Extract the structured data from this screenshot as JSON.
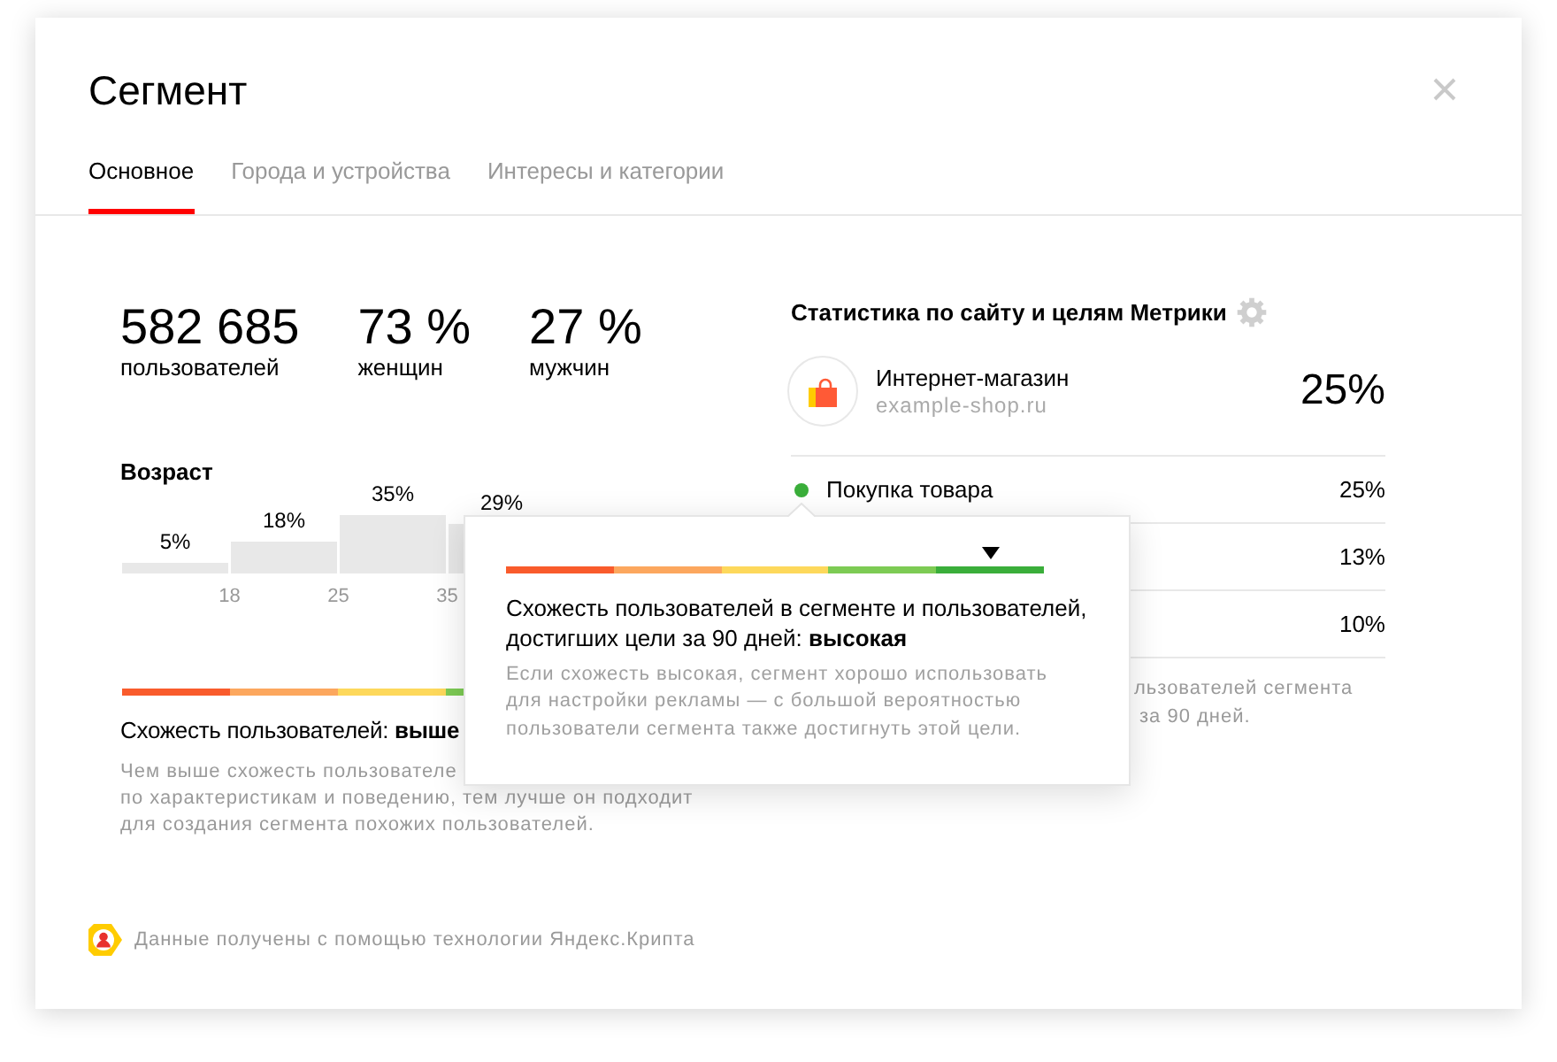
{
  "dialog": {
    "title": "Сегмент"
  },
  "tabs": [
    {
      "label": "Основное",
      "selected": true
    },
    {
      "label": "Города и устройства",
      "selected": false
    },
    {
      "label": "Интересы и категории",
      "selected": false
    }
  ],
  "summary": [
    {
      "value": "582 685",
      "label": "пользователей"
    },
    {
      "value": "73 %",
      "label": "женщин"
    },
    {
      "value": "27 %",
      "label": "мужчин"
    }
  ],
  "age": {
    "title": "Возраст",
    "bar_labels": [
      "5%",
      "18%",
      "35%",
      "29%"
    ],
    "axis_labels": [
      "18",
      "25",
      "35"
    ]
  },
  "similarity": {
    "text": "Схожесть пользователей: **выше**",
    "hint_lines": [
      "Чем выше схожесть пользователе",
      "по характеристикам и поведению, тем лучше он подходит",
      "для создания сегмента похожих пользователей."
    ]
  },
  "metrika": {
    "title": "Статистика по сайту и целям Метрики",
    "site": {
      "name": "Интернет-магазин",
      "domain": "example-shop.ru",
      "value": "25%"
    },
    "goals": [
      {
        "name": "Покупка товара",
        "value": "25%",
        "color": "#3aae3a"
      },
      {
        "value": "13%"
      },
      {
        "value": "10%"
      }
    ],
    "hint_lines": [
      "льзователей сегмента",
      "за 90 дней."
    ]
  },
  "tooltip": {
    "level": 0.9,
    "text": "Схожесть пользователей в сегменте и пользователей, достигших цели за 90 дней: **высокая**",
    "hint": "Если схожесть высокая, сегмент хорошо использовать для настройки рекламы — с большой вероятностью пользователи сегмента также достигнуть этой цели."
  },
  "footer": {
    "text": "Данные получены с помощью технологии Яндекс.Крипта"
  }
}
